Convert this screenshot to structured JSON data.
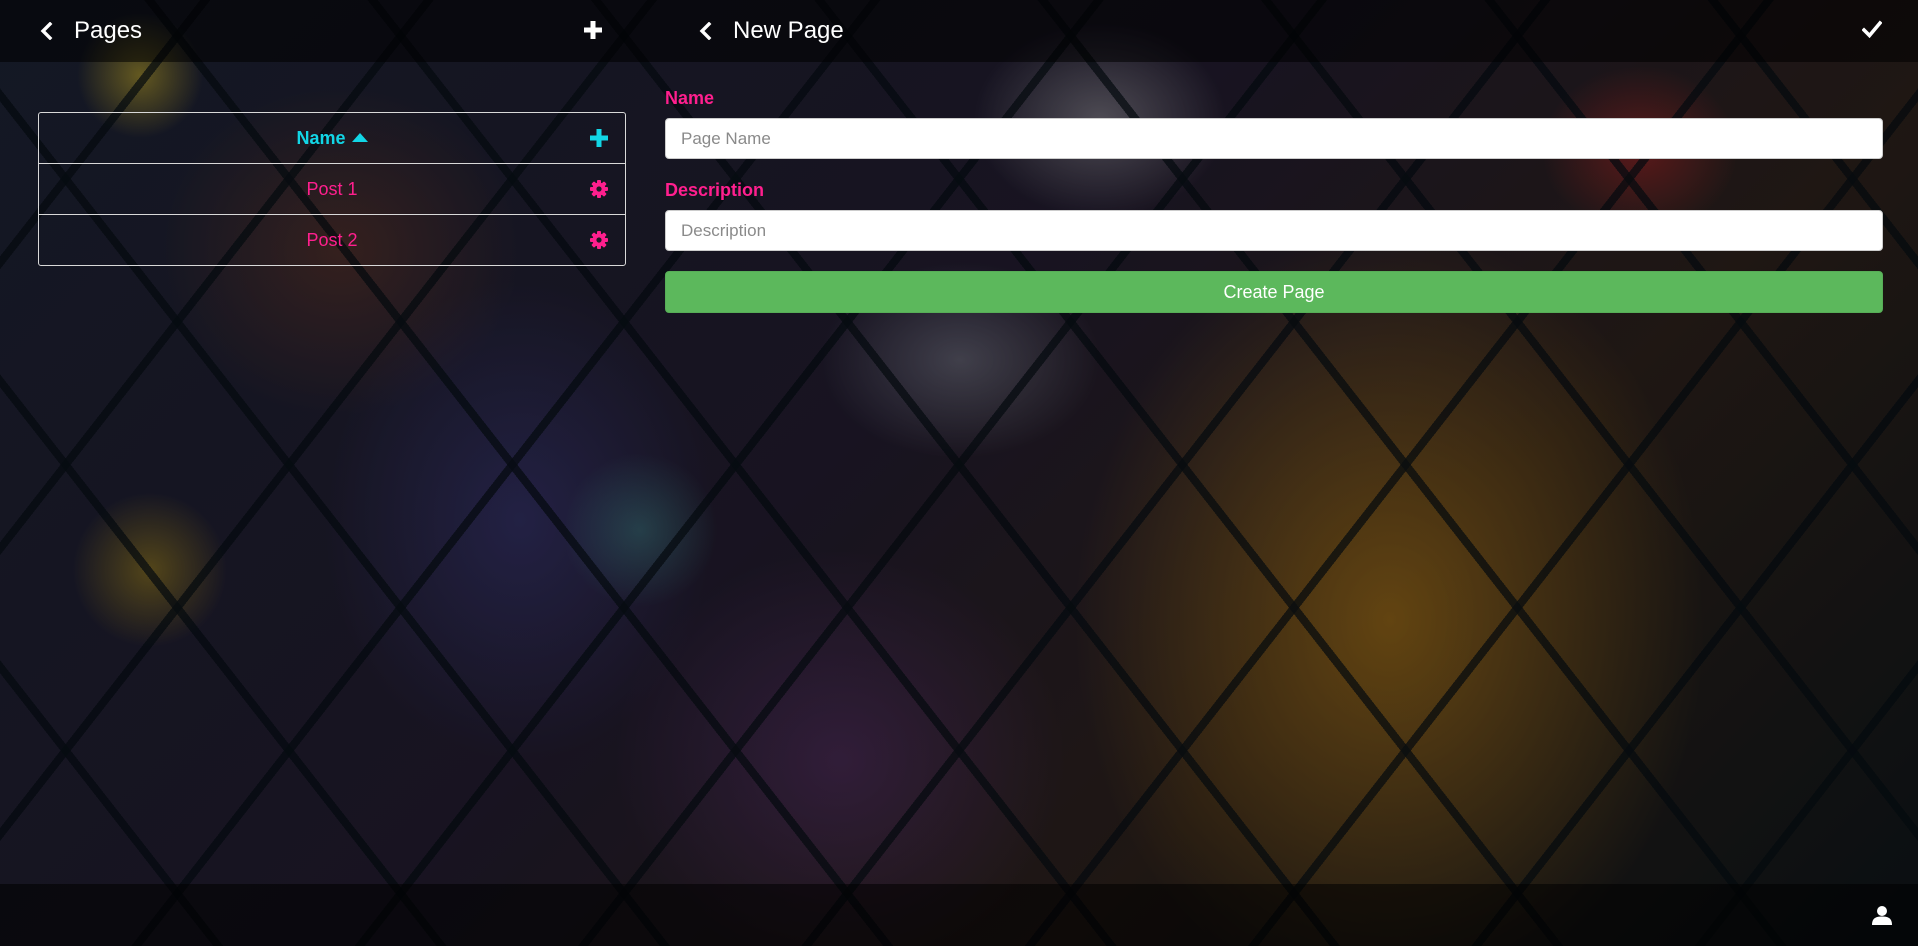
{
  "pages_panel": {
    "title": "Pages",
    "back_icon": "chevron-left-icon",
    "add_icon": "plus-icon",
    "table": {
      "header_label": "Name",
      "sort_icon": "sort-ascending-icon",
      "header_action_icon": "plus-icon",
      "rows": [
        {
          "name": "Post 1",
          "action_icon": "gear-icon"
        },
        {
          "name": "Post 2",
          "action_icon": "gear-icon"
        }
      ]
    }
  },
  "editor": {
    "title": "New Page",
    "back_icon": "chevron-left-icon",
    "confirm_icon": "check-icon",
    "fields": {
      "name": {
        "label": "Name",
        "placeholder": "Page Name",
        "value": ""
      },
      "description": {
        "label": "Description",
        "placeholder": "Description",
        "value": ""
      }
    },
    "submit_label": "Create Page"
  },
  "footer": {
    "user_icon": "user-icon"
  },
  "colors": {
    "accent_cyan": "#12d6e6",
    "accent_pink": "#ff1f8e",
    "success_green": "#5cb85c",
    "bar_background": "rgba(0,0,0,0.55)"
  }
}
